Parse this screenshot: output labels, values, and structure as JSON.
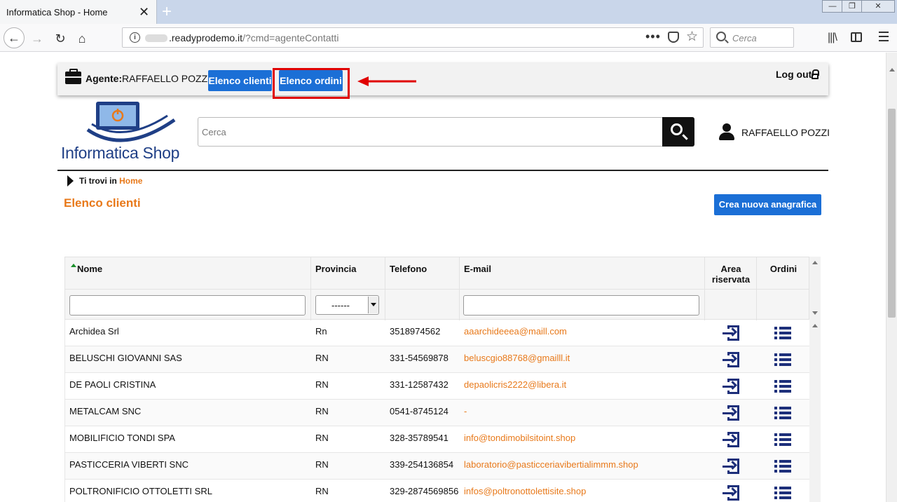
{
  "browser": {
    "tab_title": "Informatica Shop - Home",
    "tab_close": "✕",
    "new_tab": "+",
    "url_domain": ".readyprodemo.it",
    "url_path": "/?cmd=agenteContatti",
    "url_dots": "•••",
    "search_placeholder": "Cerca",
    "win_minimize": "—",
    "win_restore": "❐",
    "win_close": "✕"
  },
  "agentbar": {
    "label": "Agente:",
    "name": "RAFFAELLO POZZI",
    "btn_clienti": "Elenco clienti",
    "btn_ordini": "Elenco ordini",
    "logout": "Log out"
  },
  "header": {
    "logo_text": "Informatica Shop",
    "search_placeholder": "Cerca",
    "user_name": "RAFFAELLO POZZI"
  },
  "breadcrumb": {
    "prefix": "Ti trovi in",
    "link": "Home"
  },
  "page": {
    "title": "Elenco clienti",
    "new_button": "Crea nuova anagrafica"
  },
  "table": {
    "headers": {
      "nome": "Nome",
      "provincia": "Provincia",
      "telefono": "Telefono",
      "email": "E-mail",
      "area_line1": "Area",
      "area_line2": "riservata",
      "ordini": "Ordini"
    },
    "provincia_filter": "------",
    "rows": [
      {
        "nome": "Archidea Srl",
        "provincia": "Rn",
        "telefono": "3518974562",
        "email": "aaarchideeea@maill.com"
      },
      {
        "nome": "BELUSCHI GIOVANNI SAS",
        "provincia": "RN",
        "telefono": "331-54569878",
        "email": "beluscgio88768@gmailll.it"
      },
      {
        "nome": "DE PAOLI CRISTINA",
        "provincia": "RN",
        "telefono": "331-12587432",
        "email": "depaolicris2222@libera.it"
      },
      {
        "nome": "METALCAM SNC",
        "provincia": "RN",
        "telefono": "0541-8745124",
        "email": "-"
      },
      {
        "nome": "MOBILIFICIO TONDI SPA",
        "provincia": "RN",
        "telefono": "328-35789541",
        "email": "info@tondimobilsitoint.shop"
      },
      {
        "nome": "PASTICCERIA VIBERTI SNC",
        "provincia": "RN",
        "telefono": "339-254136854",
        "email": "laboratorio@pasticceriavibertialimmm.shop"
      },
      {
        "nome": "POLTRONIFICIO OTTOLETTI SRL",
        "provincia": "RN",
        "telefono": "329-2874569856",
        "email": "infos@poltronottolettisite.shop"
      }
    ]
  },
  "colors": {
    "accent_orange": "#e8791a",
    "button_blue": "#1b6fd6",
    "icon_navy": "#1d2f7a",
    "highlight_red": "#e00000"
  }
}
